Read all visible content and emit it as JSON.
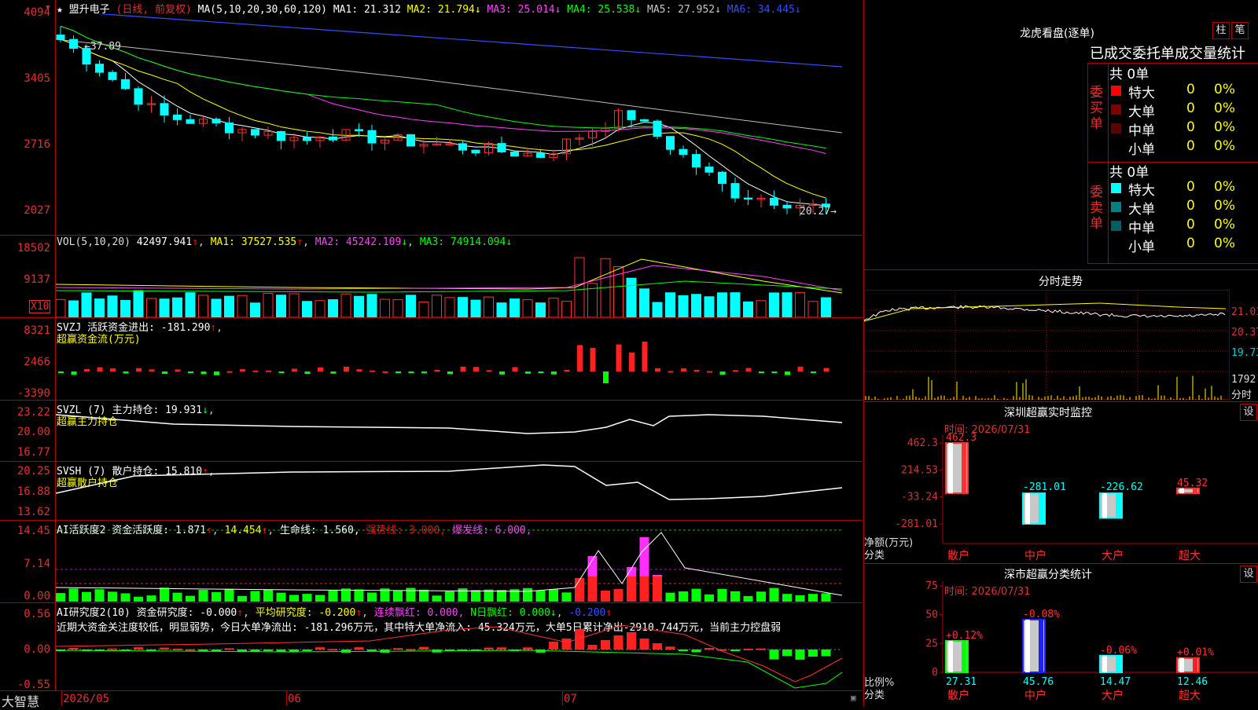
{
  "stock": {
    "star": "★",
    "name": "盟升电子",
    "mode": "(日线, 前复权)"
  },
  "main": {
    "ma_header": "MA(5,10,20,30,60,120)",
    "ma": [
      {
        "label": "MA1:",
        "value": "21.312",
        "color": "#ffffff",
        "arrow": ""
      },
      {
        "label": "MA2:",
        "value": "21.794",
        "color": "#ffff00",
        "arrow": "↓"
      },
      {
        "label": "MA3:",
        "value": "25.014",
        "color": "#ff40ff",
        "arrow": "↓"
      },
      {
        "label": "MA4:",
        "value": "25.538",
        "color": "#00ff00",
        "arrow": "↓"
      },
      {
        "label": "MA5:",
        "value": "27.952",
        "color": "#c8c8c8",
        "arrow": "↓"
      },
      {
        "label": "MA6:",
        "value": "34.445",
        "color": "#3050ff",
        "arrow": "↓"
      }
    ],
    "y_labels": [
      "4094",
      "3405",
      "2716",
      "2027"
    ],
    "hi_label": "37.89",
    "lo_label": "20.27"
  },
  "vol": {
    "title": "VOL(5,10,20)",
    "value": "42497.941",
    "ma1": "MA1: 37527.535",
    "ma2": "MA2: 45242.109",
    "ma3": "MA3: 74914.094",
    "y_labels": [
      "18502",
      "9137"
    ],
    "unit": "X10"
  },
  "svzj": {
    "title": "SVZJ  活跃资金进出: -181.290",
    "sub": "超赢资金流(万元)",
    "y_labels": [
      "8321",
      "2466",
      "-3390"
    ]
  },
  "svzl": {
    "title": "SVZL (7) 主力持仓: 19.931",
    "sub": "超赢主力持仓",
    "y_labels": [
      "23.22",
      "20.00",
      "16.77"
    ]
  },
  "svsh": {
    "title": "SVSH (7) 散户持仓: 15.810",
    "sub": "超赢散户持仓",
    "y_labels": [
      "20.25",
      "16.88",
      "13.62"
    ]
  },
  "ai_act": {
    "t1": "AI活跃度2 资金活跃度: 1.871",
    "t2": "14.454",
    "t3": "生命线: 1.560,",
    "t4": "强势线: 3.000,",
    "t5": "爆发线: 6.000,",
    "y_labels": [
      "14.45",
      "7.14",
      "0.00"
    ]
  },
  "ai_res": {
    "t1": "AI研究度2(10) 资金研究度: -0.000",
    "t2": "平均研究度: -0.200",
    "t3": "连续飘红: 0.000,",
    "t4": "N日飘红: 0.000",
    "t5": "-0.200",
    "comment": "近期大资金关注度较低，明显弱势，今日大单净流出: -181.296万元，其中特大单净流入: 45.324万元，大单5日累计净出-2910.744万元，当前主力控盘弱",
    "y_labels": [
      "0.56",
      "0.00",
      "-0.55"
    ]
  },
  "xaxis": {
    "brand": "大智慧",
    "dates": [
      "2026/05",
      "06",
      "07"
    ]
  },
  "lhb": {
    "title": "龙虎看盘(逐单)",
    "btn1": "柱",
    "btn2": "笔",
    "header": "已成交委托单成交量统计",
    "buy": {
      "side": "委买单",
      "total": "共 0单",
      "rows": [
        {
          "name": "特大",
          "n": "0",
          "p": "0%",
          "color": "#ff0000"
        },
        {
          "name": "大单",
          "n": "0",
          "p": "0%",
          "color": "#800000"
        },
        {
          "name": "中单",
          "n": "0",
          "p": "0%",
          "color": "#600000"
        },
        {
          "name": "小单",
          "n": "0",
          "p": "0%",
          "color": "#000000"
        }
      ]
    },
    "sell": {
      "side": "委卖单",
      "total": "共 0单",
      "rows": [
        {
          "name": "特大",
          "n": "0",
          "p": "0%",
          "color": "#00ffff"
        },
        {
          "name": "大单",
          "n": "0",
          "p": "0%",
          "color": "#008080"
        },
        {
          "name": "中单",
          "n": "0",
          "p": "0%",
          "color": "#006060"
        },
        {
          "name": "小单",
          "n": "0",
          "p": "0%",
          "color": "#000000"
        }
      ]
    }
  },
  "fenshi": {
    "title": "分时走势",
    "y_labels": [
      "21.01",
      "20.37",
      "19.73",
      "1792",
      "分时"
    ]
  },
  "monitor": {
    "title": "深圳超赢实时监控",
    "btn": "设",
    "time": "时间: 2026/07/31",
    "y_labels": [
      "462.3",
      "214.53",
      "-33.24",
      "-281.01"
    ],
    "xlabel1": "净额(万元)",
    "xlabel2": "分类",
    "chart_data": {
      "type": "bar",
      "categories": [
        "散户",
        "中户",
        "大户",
        "超大"
      ],
      "values": [
        462.3,
        -281.01,
        -226.62,
        45.32
      ],
      "ylim": [
        -281.01,
        462.3
      ]
    }
  },
  "classify": {
    "title": "深市超赢分类统计",
    "btn": "设",
    "time": "时间: 2026/07/31",
    "y_labels": [
      "75",
      "50",
      "25",
      "0"
    ],
    "xlabel1": "比例%",
    "xlabel2": "分类",
    "chart_data": {
      "type": "bar",
      "categories": [
        "散户",
        "中户",
        "大户",
        "超大"
      ],
      "values": [
        27.31,
        45.76,
        14.47,
        12.46
      ],
      "changes": [
        "+0.12%",
        "-0.08%",
        "-0.06%",
        "+0.01%"
      ],
      "ylim": [
        0,
        75
      ]
    }
  }
}
